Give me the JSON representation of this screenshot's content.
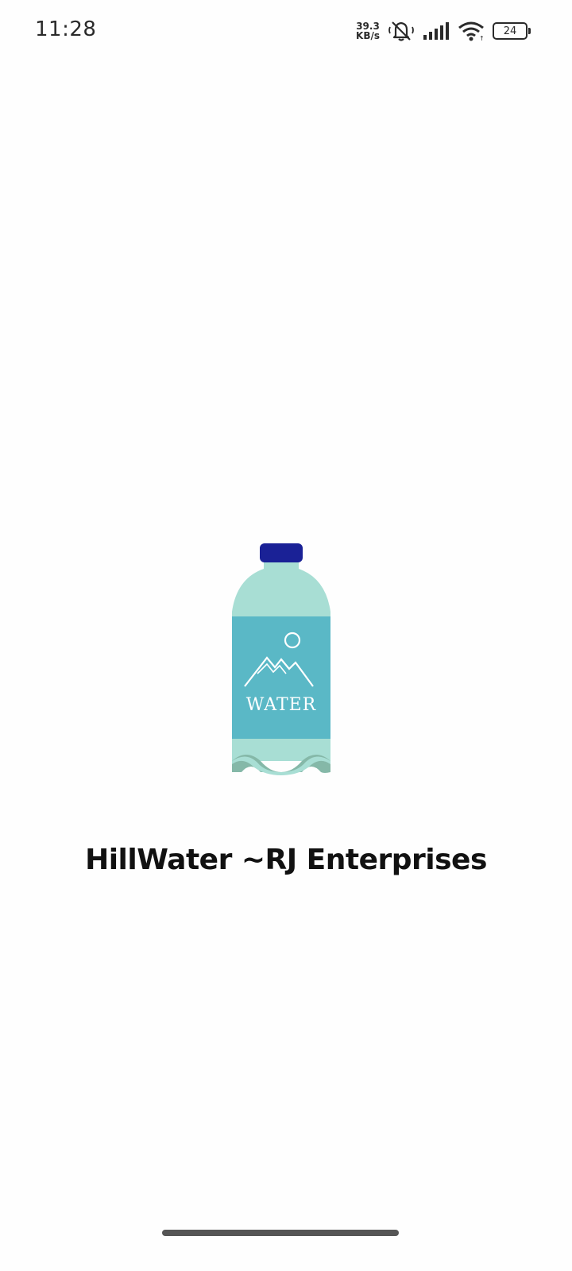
{
  "status_bar": {
    "time": "11:28",
    "net_speed_value": "39.3",
    "net_speed_unit": "KB/s",
    "icons": [
      "mute-icon",
      "signal-icon",
      "wifi-icon"
    ],
    "battery_level": "24"
  },
  "splash": {
    "logo_label": "WATER",
    "brand_title": "HillWater ~RJ Enterprises",
    "colors": {
      "cap": "#1a2196",
      "bottle_body": "#a8ded4",
      "label": "#5ab8c6",
      "wave_shade": "#85b8a8"
    }
  }
}
